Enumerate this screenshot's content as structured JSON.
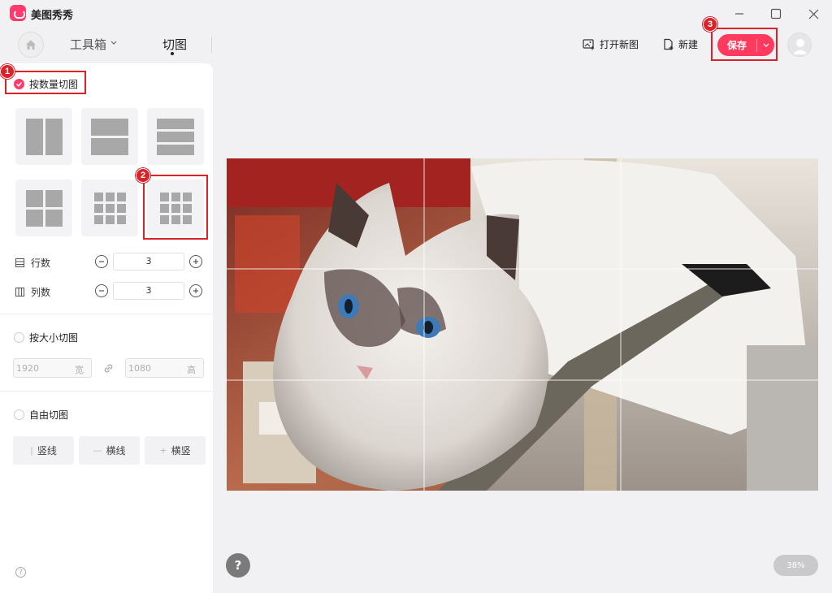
{
  "app": {
    "name": "美图秀秀"
  },
  "nav": {
    "toolbox": "工具箱",
    "current": "切图"
  },
  "actions": {
    "open_new": "打开新图",
    "new": "新建",
    "save": "保存"
  },
  "panel": {
    "mode_by_count": "按数量切图",
    "rows_label": "行数",
    "rows_value": "3",
    "cols_label": "列数",
    "cols_value": "3",
    "mode_by_size": "按大小切图",
    "width_value": "1920",
    "width_unit": "宽",
    "height_value": "1080",
    "height_unit": "高",
    "mode_free": "自由切图",
    "free_vertical": "竖线",
    "free_horizontal": "横线",
    "free_both": "横竖"
  },
  "markers": [
    "1",
    "2",
    "3"
  ],
  "canvas": {
    "zoom": "38%",
    "help": "?"
  },
  "colors": {
    "accent": "#ff3a6e",
    "save": "#ff3a5f",
    "annotation": "#d9222a"
  }
}
